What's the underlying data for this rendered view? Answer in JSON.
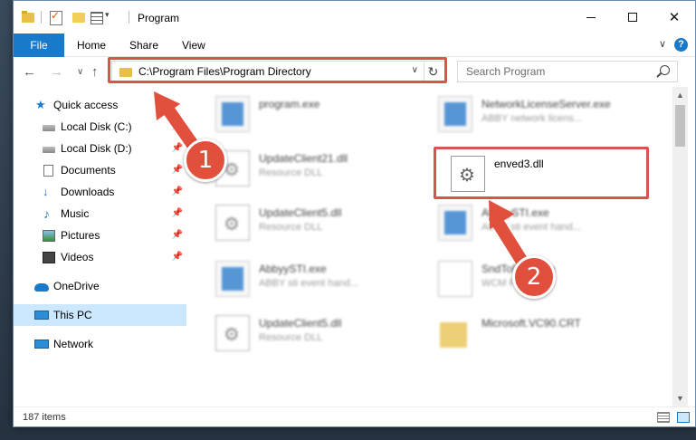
{
  "window": {
    "title": "Program",
    "controls": {
      "minimize": "",
      "maximize": "",
      "close": "✕"
    }
  },
  "ribbon": {
    "tabs": [
      "File",
      "Home",
      "Share",
      "View"
    ],
    "collapse_glyph": "∨",
    "help_glyph": "?"
  },
  "navbar": {
    "back": "←",
    "forward": "→",
    "recent": "∨",
    "up": "↑",
    "address": "C:\\Program Files\\Program Directory",
    "address_dropdown": "∨",
    "refresh": "↻",
    "search_placeholder": "Search Program"
  },
  "sidebar": {
    "items": [
      {
        "label": "Quick access",
        "icon": "star-icon"
      },
      {
        "label": "Local Disk (C:)",
        "icon": "disk-icon",
        "pinned": true
      },
      {
        "label": "Local Disk (D:)",
        "icon": "disk-icon",
        "pinned": true
      },
      {
        "label": "Documents",
        "icon": "documents-icon",
        "pinned": true
      },
      {
        "label": "Downloads",
        "icon": "download-icon",
        "pinned": true
      },
      {
        "label": "Music",
        "icon": "music-icon",
        "pinned": true
      },
      {
        "label": "Pictures",
        "icon": "pictures-icon",
        "pinned": true
      },
      {
        "label": "Videos",
        "icon": "videos-icon",
        "pinned": true
      },
      {
        "label": "OneDrive",
        "icon": "cloud-icon"
      },
      {
        "label": "This PC",
        "icon": "pc-icon",
        "selected": true
      },
      {
        "label": "Network",
        "icon": "network-icon"
      }
    ],
    "pin_glyph": "📌"
  },
  "files": [
    {
      "name": "program.exe",
      "desc": "",
      "icon": "exe-icon"
    },
    {
      "name": "NetworkLicenseServer.exe",
      "desc": "ABBY network licens...",
      "icon": "exe-icon"
    },
    {
      "name": "UpdateClient21.dll",
      "desc": "Resource DLL",
      "icon": "dll-icon"
    },
    {
      "name": "enved3.dll",
      "desc": "",
      "icon": "dll-icon"
    },
    {
      "name": "UpdateClient5.dll",
      "desc": "Resource DLL",
      "icon": "dll-icon"
    },
    {
      "name": "AbbyySTI.exe",
      "desc": "ABBY sti event hand...",
      "icon": "exe-icon"
    },
    {
      "name": "AbbyySTI.exe",
      "desc": "ABBY sti event hand...",
      "icon": "exe-icon"
    },
    {
      "name": "SndToFile.wcm",
      "desc": "WCM File",
      "icon": "blank-file-icon"
    },
    {
      "name": "UpdateClient5.dll",
      "desc": "Resource DLL",
      "icon": "dll-icon"
    },
    {
      "name": "Microsoft.VC90.CRT",
      "desc": "",
      "icon": "folder-icon"
    }
  ],
  "scrollbar": {
    "up": "▲",
    "down": "▼"
  },
  "status": {
    "items_count": "187 items"
  },
  "annotations": {
    "step1": "1",
    "step2": "2",
    "color": "#e0503c"
  }
}
